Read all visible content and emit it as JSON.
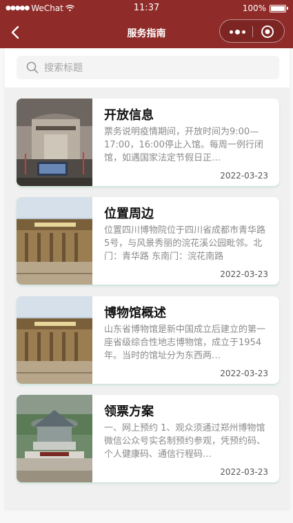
{
  "status": {
    "carrier": "WeChat",
    "time": "11:37",
    "battery": "100%"
  },
  "nav": {
    "title": "服务指南"
  },
  "search": {
    "placeholder": "搜索标题"
  },
  "items": [
    {
      "title": "开放信息",
      "desc": "票务说明疫情期间，开放时间为9:00—17:00，16:00停止入馆。每周一例行闭馆，如遇国家法定节假日正…",
      "date": "2022-03-23"
    },
    {
      "title": "位置周边",
      "desc": "位置四川博物院位于四川省成都市青华路5号，与风景秀丽的浣花溪公园毗邻。北门：青华路 东南门：浣花南路",
      "date": "2022-03-23"
    },
    {
      "title": "博物馆概述",
      "desc": "山东省博物馆是新中国成立后建立的第一座省级综合性地志博物馆，成立于1954年。当时的馆址分为东西两…",
      "date": "2022-03-23"
    },
    {
      "title": "领票方案",
      "desc": "一、网上预约 1、观众须通过郑州博物馆微信公众号实名制预约参观，凭预约码、个人健康码、通信行程码…",
      "date": "2022-03-23"
    }
  ],
  "colors": {
    "brand": "#8f2b28",
    "card_shadow": "#afd7c8"
  }
}
